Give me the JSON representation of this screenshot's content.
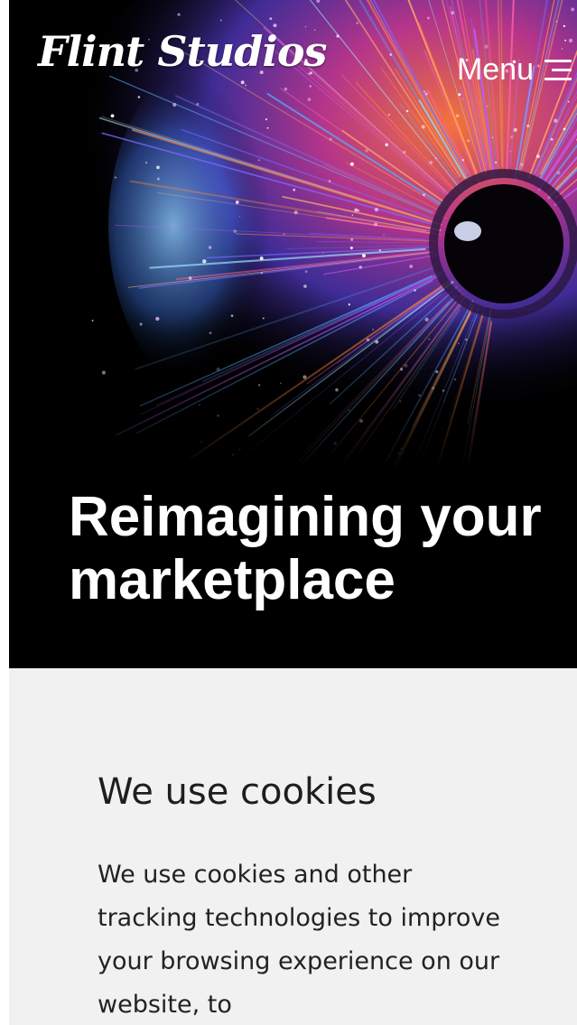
{
  "header": {
    "logo_text": "Flint Studios",
    "menu_label": "Menu",
    "menu_icon": "hamburger-menu-icon"
  },
  "hero": {
    "heading": "Reimagining your marketplace",
    "image": "abstract-eye-fiber-optic-artwork"
  },
  "cookie_banner": {
    "title": "We use cookies",
    "body": "We use cookies and other tracking technologies to improve your browsing experience on our website, to"
  },
  "colors": {
    "hero_background": "#000000",
    "banner_background": "#f1f1f1",
    "text_light": "#ffffff",
    "text_dark": "#1e1e1e"
  }
}
